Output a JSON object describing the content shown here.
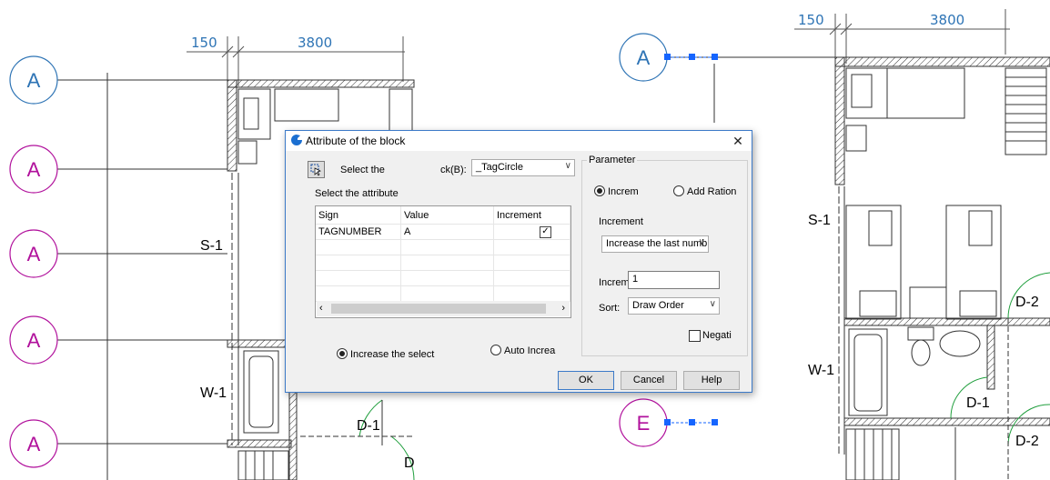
{
  "drawing": {
    "dims_left": [
      "150",
      "3800"
    ],
    "dims_right": [
      "150",
      "3800"
    ],
    "wall_labels_left": [
      "S-1",
      "W-1"
    ],
    "door_labels_left": [
      "D-1",
      "D"
    ],
    "wall_labels_right": [
      "S-1",
      "W-1"
    ],
    "door_labels_right": [
      "D-2",
      "D-1",
      "D-2"
    ],
    "tags_left": [
      "A",
      "A",
      "A",
      "A",
      "A"
    ],
    "tag_right_top": "A",
    "tag_right_bottom": "E",
    "colors": {
      "tag_blue": "#2e74b5",
      "tag_magenta": "#b1119c",
      "grip": "#1565ff"
    }
  },
  "dialog": {
    "title": "Attribute of the block",
    "close_glyph": "✕",
    "pick_label": "Select the",
    "block_label": "ck(B):",
    "block_value": "_TagCircle",
    "attr_label": "Select the attribute",
    "grid": {
      "headers": [
        "Sign",
        "Value",
        "Increment"
      ],
      "rows": [
        {
          "sign": "TAGNUMBER",
          "value": "A",
          "increment": true
        }
      ]
    },
    "radio_increase_select": "Increase the select",
    "radio_auto_increase": "Auto Increa",
    "parameter": {
      "title": "Parameter",
      "radio_increm": "Increm",
      "radio_add_ration": "Add Ration",
      "increment_label": "Increment",
      "increment_value": "Increase the last numb",
      "increm_label": "Increm",
      "increm_value": "1",
      "sort_label": "Sort:",
      "sort_value": "Draw Order",
      "negative_label": "Negati"
    },
    "buttons": {
      "ok": "OK",
      "cancel": "Cancel",
      "help": "Help"
    }
  }
}
